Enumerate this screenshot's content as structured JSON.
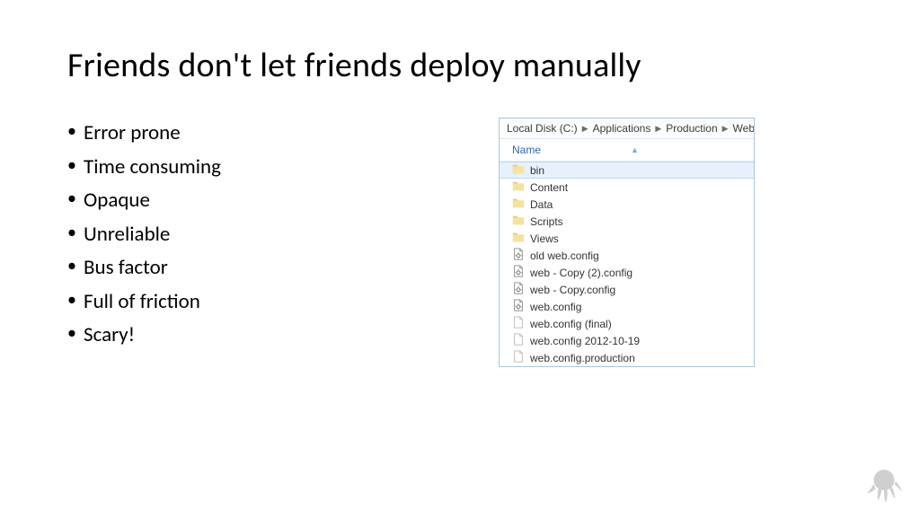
{
  "title": "Friends don't let friends deploy manually",
  "bullets": [
    "Error prone",
    "Time consuming",
    "Opaque",
    "Unreliable",
    "Bus factor",
    "Full of friction",
    "Scary!"
  ],
  "explorer": {
    "breadcrumb": [
      "Local Disk (C:)",
      "Applications",
      "Production",
      "Web"
    ],
    "column_header": "Name",
    "items": [
      {
        "name": "bin",
        "type": "folder",
        "selected": true
      },
      {
        "name": "Content",
        "type": "folder",
        "selected": false
      },
      {
        "name": "Data",
        "type": "folder",
        "selected": false
      },
      {
        "name": "Scripts",
        "type": "folder",
        "selected": false
      },
      {
        "name": "Views",
        "type": "folder",
        "selected": false
      },
      {
        "name": "old web.config",
        "type": "config",
        "selected": false
      },
      {
        "name": "web - Copy (2).config",
        "type": "config",
        "selected": false
      },
      {
        "name": "web - Copy.config",
        "type": "config",
        "selected": false
      },
      {
        "name": "web.config",
        "type": "config",
        "selected": false
      },
      {
        "name": "web.config (final)",
        "type": "file",
        "selected": false
      },
      {
        "name": "web.config 2012-10-19",
        "type": "file",
        "selected": false
      },
      {
        "name": "web.config.production",
        "type": "file",
        "selected": false
      }
    ]
  }
}
